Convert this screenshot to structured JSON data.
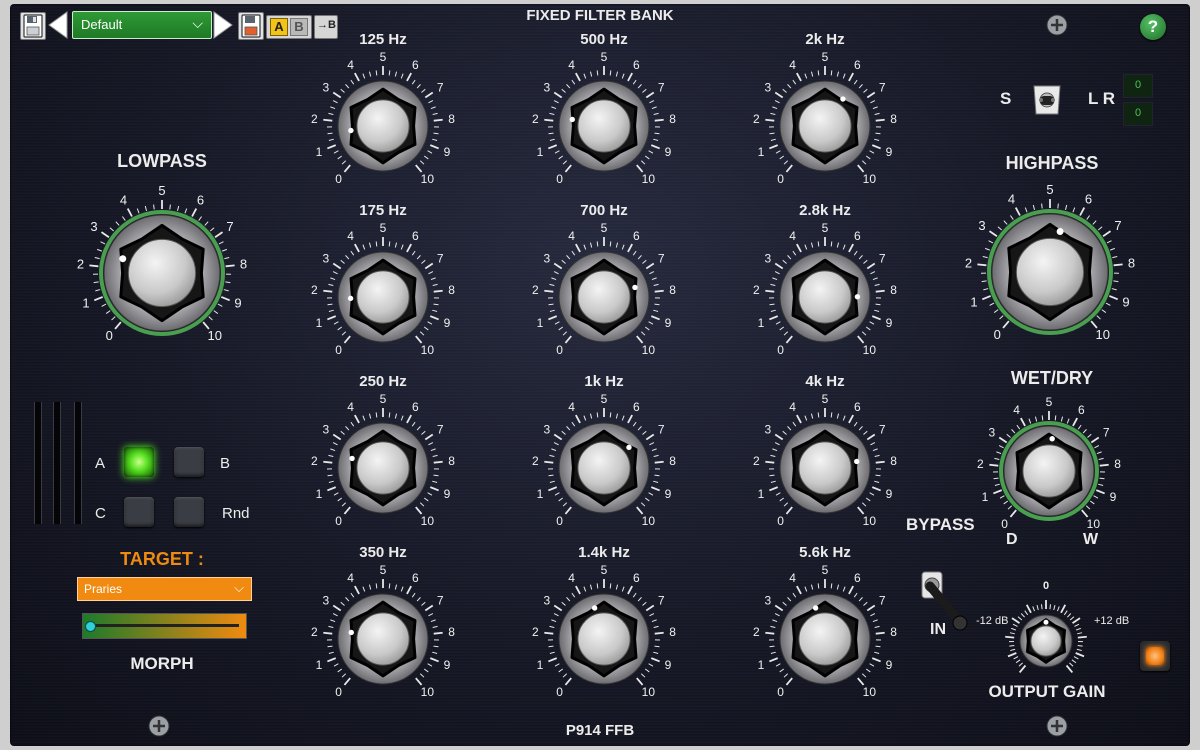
{
  "header": {
    "title": "FIXED FILTER BANK",
    "preset_name": "Default",
    "ab_a": "A",
    "ab_b": "B",
    "copy_ab": "→B",
    "help": "?"
  },
  "footer": {
    "product_name": "P914 FFB"
  },
  "scale_labels": [
    "0",
    "1",
    "2",
    "3",
    "4",
    "5",
    "6",
    "7",
    "8",
    "9",
    "10"
  ],
  "lowpass": {
    "label": "LOWPASS",
    "value": 2.5
  },
  "highpass": {
    "label": "HIGHPASS",
    "value": 5.5
  },
  "bands": [
    {
      "label": "125 Hz",
      "value": 1.5
    },
    {
      "label": "500 Hz",
      "value": 2.2
    },
    {
      "label": "2k Hz",
      "value": 6.2
    },
    {
      "label": "175 Hz",
      "value": 1.7
    },
    {
      "label": "700 Hz",
      "value": 7.6
    },
    {
      "label": "2.8k Hz",
      "value": 8.2
    },
    {
      "label": "250 Hz",
      "value": 2.4
    },
    {
      "label": "1k Hz",
      "value": 6.8
    },
    {
      "label": "4k Hz",
      "value": 7.8
    },
    {
      "label": "350 Hz",
      "value": 2.2
    },
    {
      "label": "1.4k Hz",
      "value": 4.4
    },
    {
      "label": "5.6k Hz",
      "value": 4.4
    }
  ],
  "stereo": {
    "label_s": "S",
    "label_lr": "L R",
    "display_top": "0",
    "display_bottom": "0"
  },
  "wetdry": {
    "label": "WET/DRY",
    "label_d": "D",
    "label_w": "W",
    "value": 5.2
  },
  "bypass": {
    "label": "BYPASS",
    "state_label": "IN"
  },
  "output_gain": {
    "label": "OUTPUT GAIN",
    "min_label": "-12 dB",
    "center_label": "0",
    "max_label": "+12 dB",
    "value": 5.0
  },
  "morph": {
    "slot_a": "A",
    "slot_b": "B",
    "slot_c": "C",
    "slot_rnd": "Rnd",
    "active_slot": "A",
    "target_label": "TARGET :",
    "target_value": "Praries",
    "label": "MORPH",
    "value": 0.0
  },
  "colors": {
    "accent_green": "#1f8a2a",
    "knob_ring_green": "#4a9e4f",
    "target_orange": "#f08a10",
    "led_on": "#5cff2b",
    "help_green": "#2e8b3a"
  },
  "icons": {
    "save": "floppy-disk-icon",
    "prev": "triangle-left-icon",
    "next": "triangle-right-icon",
    "save_as": "floppy-disk-icon",
    "screw": "screw-icon"
  }
}
